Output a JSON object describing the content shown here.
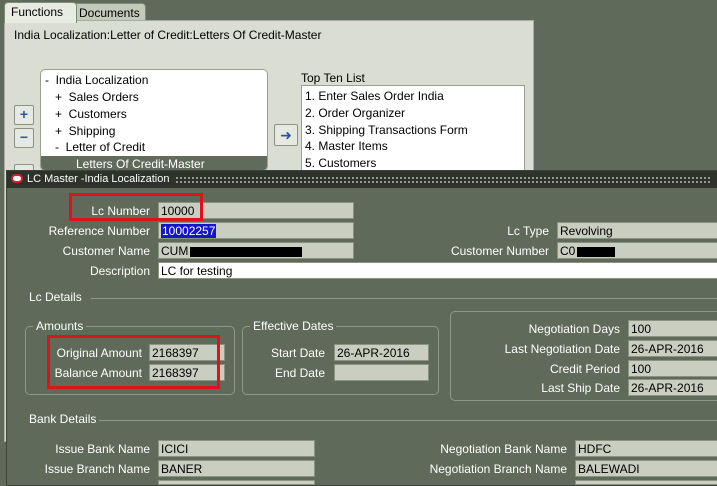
{
  "navigator": {
    "tabs": [
      "Functions",
      "Documents"
    ],
    "path": "India Localization:Letter of Credit:Letters Of Credit-Master",
    "tree": [
      "-  India Localization",
      "   +  Sales Orders",
      "   +  Customers",
      "   +  Shipping",
      "   -  Letter of Credit",
      "Letters Of Credit-Master"
    ],
    "top_ten_label": "Top Ten List",
    "top_ten": [
      "1. Enter Sales Order India",
      "2. Order Organizer",
      "3. Shipping Transactions Form",
      "4. Master Items",
      "5. Customers"
    ]
  },
  "lc_master": {
    "title": "LC Master -India Localization",
    "lc_number_label": "Lc Number",
    "lc_number": "10000",
    "reference_number_label": "Reference Number",
    "reference_number": "10002257",
    "lc_type_label": "Lc Type",
    "lc_type": "Revolving",
    "customer_name_label": "Customer Name",
    "customer_name_prefix": "CUM",
    "customer_number_label": "Customer Number",
    "customer_number_prefix": "C0",
    "description_label": "Description",
    "description": "LC for testing",
    "lc_details_label": "Lc Details",
    "amounts_label": "Amounts",
    "original_amount_label": "Original Amount",
    "original_amount": "2168397",
    "balance_amount_label": "Balance Amount",
    "balance_amount": "2168397",
    "effective_dates_label": "Effective Dates",
    "start_date_label": "Start Date",
    "start_date": "26-APR-2016",
    "end_date_label": "End Date",
    "end_date": "",
    "negotiation_days_label": "Negotiation Days",
    "negotiation_days": "100",
    "last_negotiation_date_label": "Last Negotiation Date",
    "last_negotiation_date": "26-APR-2016",
    "credit_period_label": "Credit Period",
    "credit_period": "100",
    "last_ship_date_label": "Last Ship Date",
    "last_ship_date": "26-APR-2016",
    "bank_details_label": "Bank Details",
    "issue_bank_name_label": "Issue Bank Name",
    "issue_bank_name": "ICICI",
    "issue_branch_name_label": "Issue Branch Name",
    "issue_branch_name": "BANER",
    "negotiation_bank_name_label": "Negotiation Bank Name",
    "negotiation_bank_name": "HDFC",
    "negotiation_branch_name_label": "Negotiation Branch Name",
    "negotiation_branch_name": "BALEWADI"
  },
  "colors": {
    "window_bg": "#5f6a5a",
    "annotation_red": "#e0101c",
    "selection_blue": "#1414c8"
  }
}
